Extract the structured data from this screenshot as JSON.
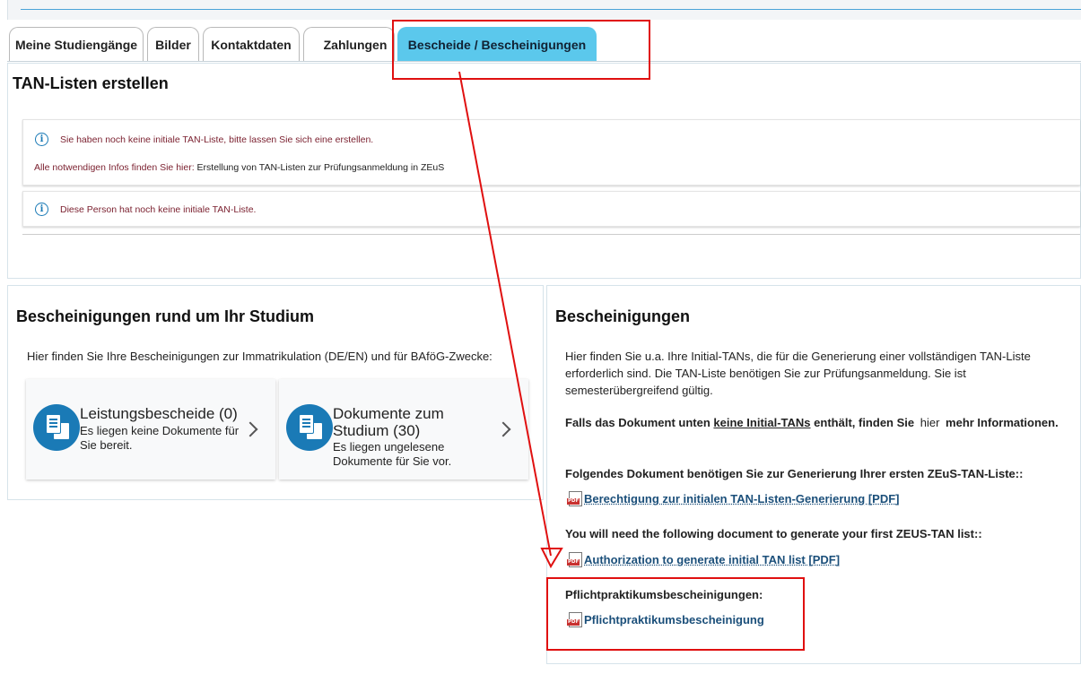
{
  "tabs": [
    {
      "label": "Meine Studiengänge"
    },
    {
      "label": "Bilder"
    },
    {
      "label": "Kontaktdaten"
    },
    {
      "label": "Zahlungen"
    },
    {
      "label": "Bescheide / Bescheinigungen",
      "active": true
    }
  ],
  "tan_section": {
    "title": "TAN-Listen erstellen",
    "alert1_line1": "Sie haben noch keine initiale TAN-Liste, bitte lassen Sie sich eine erstellen.",
    "alert1_line2_prefix": "Alle notwendigen Infos finden Sie hier: ",
    "alert1_link": "Erstellung von TAN-Listen zur Prüfungsanmeldung in ZEuS",
    "alert2": "Diese Person hat noch keine initiale TAN-Liste."
  },
  "left_section": {
    "title": "Bescheinigungen rund um Ihr Studium",
    "intro": "Hier finden Sie Ihre Bescheinigungen zur Immatrikulation (DE/EN) und für BAföG-Zwecke:",
    "cards": [
      {
        "title": "Leistungsbescheide (0)",
        "subtitle": "Es liegen keine Dokumente für Sie bereit."
      },
      {
        "title": "Dokumente zum Studium (30)",
        "subtitle": "Es liegen ungelesene Dokumente für Sie vor."
      }
    ]
  },
  "right_section": {
    "title": "Bescheinigungen",
    "intro": "Hier finden Sie u.a. Ihre Initial-TANs, die für die Generierung einer vollständigen TAN-Liste erforderlich sind. Die TAN-Liste benötigen Sie zur Prüfungsanmeldung. Sie ist semesterübergreifend gültig.",
    "notice_prefix": "Falls das Dokument unten ",
    "notice_underlined": "keine Initial-TANs",
    "notice_middle": " enthält, finden Sie ",
    "notice_link": "hier",
    "notice_suffix": " mehr Informationen.",
    "de_heading": "Folgendes Dokument benötigen Sie zur Generierung Ihrer ersten ZEuS-TAN-Liste::",
    "de_link": "Berechtigung zur initialen TAN-Listen-Generierung [PDF]",
    "en_heading": "You will need the following document to generate your first ZEUS-TAN list::",
    "en_link": "Authorization to generate initial TAN list [PDF]",
    "pp_heading": "Pflichtpraktikumsbescheinigungen:",
    "pp_link": "Pflichtpraktikumsbescheinigung"
  },
  "colors": {
    "accent": "#5bc8ec",
    "link": "#1b4f7a",
    "annotation": "#e01010",
    "alert_text": "#7a1f2e"
  },
  "icons": [
    "info-icon",
    "documents-icon",
    "chevron-right-icon",
    "pdf-icon"
  ]
}
